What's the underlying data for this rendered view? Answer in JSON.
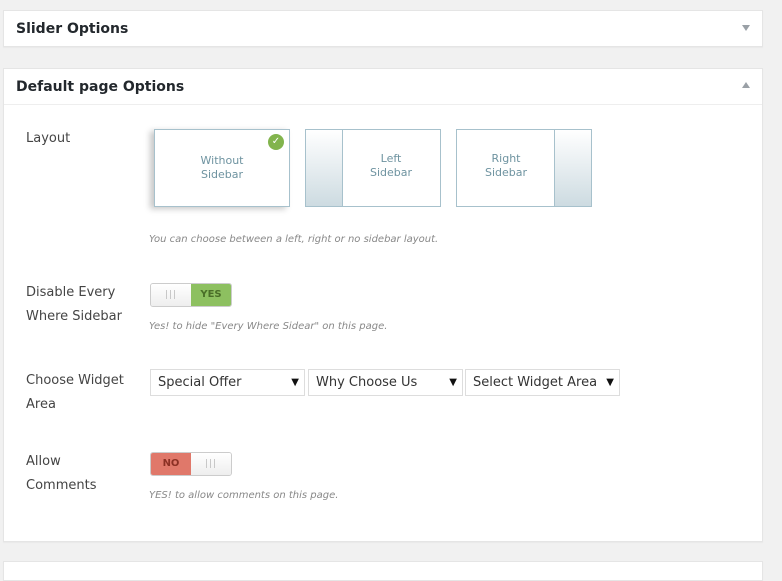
{
  "panels": {
    "slider": {
      "title": "Slider Options"
    },
    "default": {
      "title": "Default page Options"
    }
  },
  "layout": {
    "label": "Layout",
    "options": [
      {
        "line1": "Without",
        "line2": "Sidebar",
        "selected": true
      },
      {
        "line1": "Left",
        "line2": "Sidebar",
        "selected": false
      },
      {
        "line1": "Right",
        "line2": "Sidebar",
        "selected": false
      }
    ],
    "description": "You can choose between a left, right or no sidebar layout."
  },
  "disable_sidebar": {
    "label_line1": "Disable Every",
    "label_line2": "Where Sidebar",
    "state": "YES",
    "handle": "|||",
    "description": "Yes! to hide \"Every Where Sidear\" on this page."
  },
  "widget_area": {
    "label_line1": "Choose Widget",
    "label_line2": "Area",
    "selects": [
      {
        "value": "Special Offer"
      },
      {
        "value": "Why Choose Us"
      },
      {
        "value": "Select Widget Area"
      }
    ]
  },
  "comments": {
    "label_line1": "Allow",
    "label_line2": "Comments",
    "state": "NO",
    "handle": "|||",
    "description": "YES! to allow comments on this page."
  },
  "icons": {
    "check": "check-icon",
    "collapse": "arrow-icon"
  },
  "colors": {
    "selected_check": "#82b44d",
    "yes": "#8dc060",
    "no": "#e0786a",
    "layout_border": "#a7c1cc"
  }
}
